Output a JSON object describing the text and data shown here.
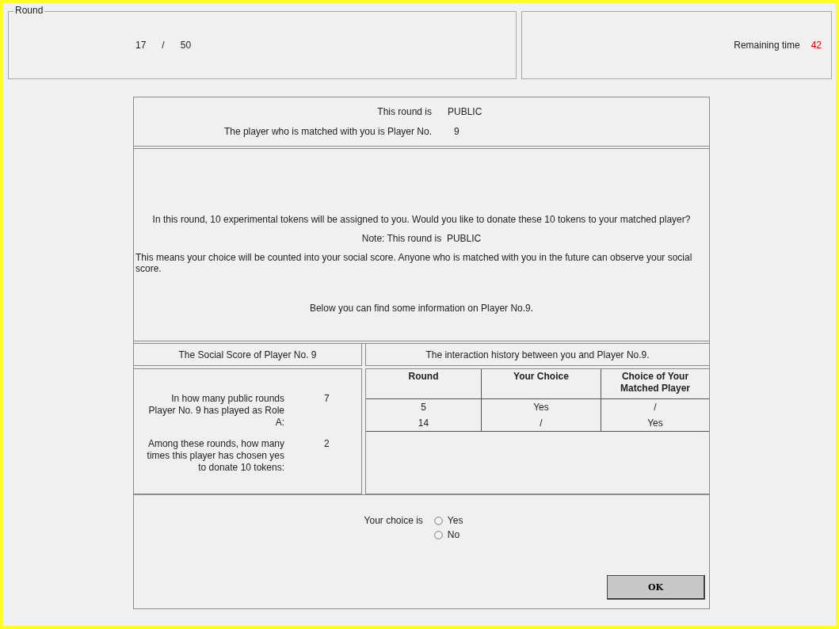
{
  "round": {
    "legend": "Round",
    "current": "17",
    "separator": "/",
    "total": "50"
  },
  "timer": {
    "label": "Remaining time",
    "value": "42"
  },
  "header": {
    "round_type_label": "This round is",
    "round_type": "PUBLIC",
    "matched_label": "The player who is matched with you is Player No.",
    "matched_player": "9"
  },
  "message": {
    "question": "In this round, 10 experimental tokens will be assigned to you. Would you like to donate these 10 tokens to your matched player?",
    "note": "Note: This round is  PUBLIC",
    "explanation": "This means your choice will be counted into your social score. Anyone who is matched with you in the future can observe your social score.",
    "info": "Below you can find some information on Player No.9."
  },
  "social_score": {
    "title": "The Social Score of Player No. 9",
    "items": [
      {
        "label": "In how many public rounds Player No. 9 has played as Role A:",
        "value": "7"
      },
      {
        "label": "Among these rounds, how many times this player has chosen yes to donate 10 tokens:",
        "value": "2"
      }
    ]
  },
  "history": {
    "title": "The interaction history between you and Player No.9.",
    "columns": [
      "Round",
      "Your Choice",
      "Choice of Your Matched Player"
    ],
    "rows": [
      [
        "5",
        "Yes",
        "/"
      ],
      [
        "14",
        "/",
        "Yes"
      ]
    ]
  },
  "choice": {
    "label": "Your choice is",
    "options": [
      {
        "label": "Yes",
        "selected": false
      },
      {
        "label": "No",
        "selected": false
      }
    ]
  },
  "ok_button": "OK"
}
